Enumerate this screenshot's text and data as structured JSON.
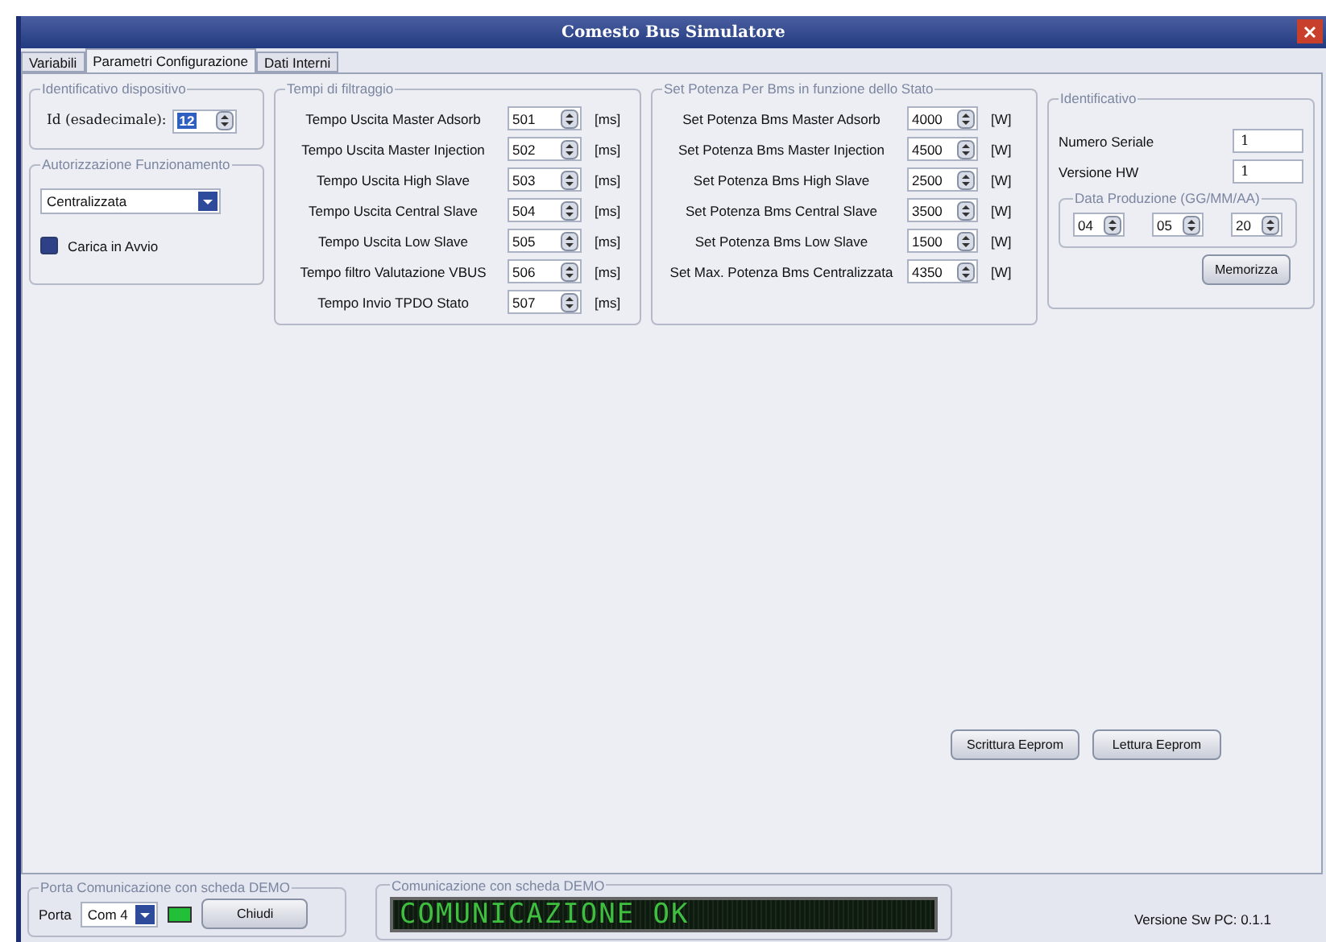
{
  "window": {
    "title": "Comesto Bus Simulatore"
  },
  "tabs": [
    {
      "label": "Variabili",
      "selected": false
    },
    {
      "label": "Parametri Configurazione",
      "selected": true
    },
    {
      "label": "Dati Interni",
      "selected": false
    }
  ],
  "device_id": {
    "title": "Identificativo dispositivo",
    "label": "Id (esadecimale):",
    "value": "12"
  },
  "authorization": {
    "title": "Autorizzazione Funzionamento",
    "mode": "Centralizzata",
    "autoload": {
      "label": "Carica in Avvio",
      "checked": true
    }
  },
  "filter_times": {
    "title": "Tempi di filtraggio",
    "rows": [
      {
        "label": "Tempo Uscita Master Adsorb",
        "value": "501",
        "unit": "[ms]"
      },
      {
        "label": "Tempo Uscita Master Injection",
        "value": "502",
        "unit": "[ms]"
      },
      {
        "label": "Tempo Uscita High Slave",
        "value": "503",
        "unit": "[ms]"
      },
      {
        "label": "Tempo Uscita Central Slave",
        "value": "504",
        "unit": "[ms]"
      },
      {
        "label": "Tempo Uscita Low Slave",
        "value": "505",
        "unit": "[ms]"
      },
      {
        "label": "Tempo filtro Valutazione VBUS",
        "value": "506",
        "unit": "[ms]"
      },
      {
        "label": "Tempo Invio TPDO Stato",
        "value": "507",
        "unit": "[ms]"
      }
    ]
  },
  "power": {
    "title": "Set Potenza Per Bms in funzione dello Stato",
    "rows": [
      {
        "label": "Set Potenza Bms Master Adsorb",
        "value": "4000",
        "unit": "[W]"
      },
      {
        "label": "Set Potenza Bms Master Injection",
        "value": "4500",
        "unit": "[W]"
      },
      {
        "label": "Set Potenza Bms  High Slave",
        "value": "2500",
        "unit": "[W]"
      },
      {
        "label": "Set Potenza Bms  Central Slave",
        "value": "3500",
        "unit": "[W]"
      },
      {
        "label": "Set Potenza Bms Low Slave",
        "value": "1500",
        "unit": "[W]"
      },
      {
        "label": "Set Max. Potenza Bms Centralizzata",
        "value": "4350",
        "unit": "[W]"
      }
    ]
  },
  "identification": {
    "title": "Identificativo",
    "fields": [
      {
        "label": "Numero Seriale",
        "value": "1"
      },
      {
        "label": "Versione HW",
        "value": "1"
      }
    ],
    "date": {
      "title": "Data Produzione (GG/MM/AA)",
      "parts": [
        "04",
        "05",
        "20"
      ]
    },
    "button": "Memorizza"
  },
  "eeprom_buttons": [
    "Scrittura Eeprom",
    "Lettura Eeprom"
  ],
  "port": {
    "title": "Porta Comunicazione con scheda DEMO",
    "label": "Porta",
    "value": "Com 4",
    "led_on": true,
    "button": "Chiudi"
  },
  "communication": {
    "title": "Comunicazione con scheda DEMO",
    "message": "COMUNICAZIONE OK"
  },
  "version": "Versione Sw PC: 0.1.1"
}
